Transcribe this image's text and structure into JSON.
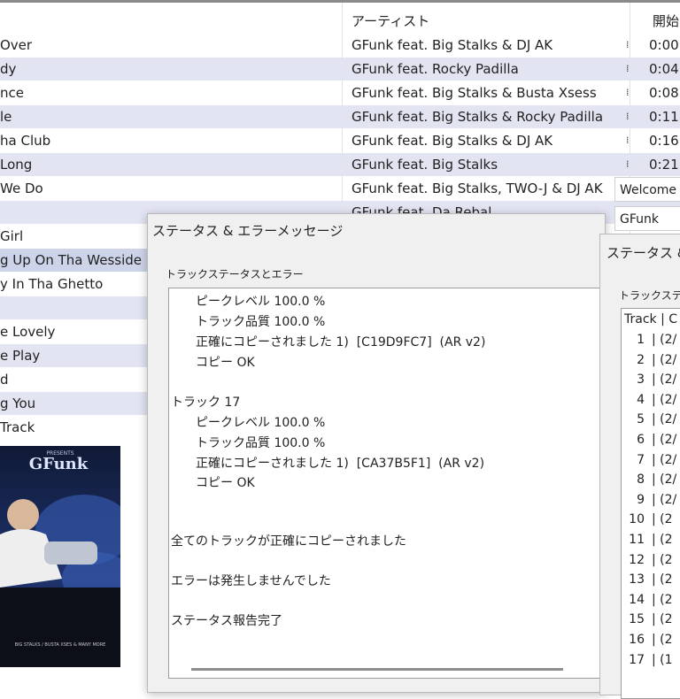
{
  "columns": {
    "artist": "アーティスト",
    "start": "開始"
  },
  "tracks": [
    {
      "title": "Over",
      "artist": "GFunk feat. Big Stalks & DJ AK",
      "start": "0:00:",
      "mark": "⁞"
    },
    {
      "title": "dy",
      "artist": "GFunk feat. Rocky Padilla",
      "start": "0:04:",
      "mark": "⁞"
    },
    {
      "title": "nce",
      "artist": "GFunk feat. Big Stalks & Busta Xsess",
      "start": "0:08:",
      "mark": "⁞"
    },
    {
      "title": "le",
      "artist": "GFunk feat. Big Stalks & Rocky Padilla",
      "start": "0:11:",
      "mark": "⁞"
    },
    {
      "title": "ha Club",
      "artist": "GFunk feat. Big Stalks & DJ AK",
      "start": "0:16:",
      "mark": "⁞"
    },
    {
      "title": " Long",
      "artist": "GFunk feat. Big Stalks",
      "start": "0:21:",
      "mark": "⁞"
    },
    {
      "title": "We Do",
      "artist": "GFunk feat. Big Stalks, TWO-J & DJ AK",
      "start": "",
      "mark": "⁞"
    },
    {
      "title": "",
      "artist": "GFunk feat. Da Rebal",
      "start": "",
      "mark": ""
    },
    {
      "title": "Girl",
      "artist": "",
      "start": "",
      "mark": ""
    },
    {
      "title": "g Up On Tha Wesside",
      "artist": "",
      "start": "",
      "mark": ""
    },
    {
      "title": "y In Tha Ghetto",
      "artist": "",
      "start": "",
      "mark": ""
    },
    {
      "title": "",
      "artist": "",
      "start": "",
      "mark": ""
    },
    {
      "title": "e Lovely",
      "artist": "",
      "start": "",
      "mark": ""
    },
    {
      "title": "e Play",
      "artist": "",
      "start": "",
      "mark": ""
    },
    {
      "title": "d",
      "artist": "",
      "start": "",
      "mark": ""
    },
    {
      "title": "g You",
      "artist": "",
      "start": "",
      "mark": ""
    },
    {
      "title": "Track",
      "artist": "",
      "start": "",
      "mark": ""
    }
  ],
  "fields": {
    "album": "Welcome",
    "artist": "GFunk"
  },
  "status_dialog": {
    "title": "ステータス & エラーメッセージ",
    "label": "トラックステータスとエラー",
    "lines": [
      "ピークレベル 100.0 %",
      "トラック品質 100.0 %",
      "正確にコピーされました 1)  [C19D9FC7]  (AR v2)",
      "コピー OK",
      "トラック 17",
      "ピークレベル 100.0 %",
      "トラック品質 100.0 %",
      "正確にコピーされました 1)  [CA37B5F1]  (AR v2)",
      "コピー OK",
      "全てのトラックが正確にコピーされました",
      "エラーは発生しませんでした",
      "ステータス報告完了"
    ]
  },
  "second_dialog": {
    "title": "ステータス & エ",
    "label": "トラックステー",
    "header": "Track | C",
    "rows": [
      {
        "n": "1",
        "v": "| (2/"
      },
      {
        "n": "2",
        "v": "| (2/"
      },
      {
        "n": "3",
        "v": "| (2/"
      },
      {
        "n": "4",
        "v": "| (2/"
      },
      {
        "n": "5",
        "v": "| (2/"
      },
      {
        "n": "6",
        "v": "| (2/"
      },
      {
        "n": "7",
        "v": "| (2/"
      },
      {
        "n": "8",
        "v": "| (2/"
      },
      {
        "n": "9",
        "v": "| (2/"
      },
      {
        "n": "10",
        "v": "| (2"
      },
      {
        "n": "11",
        "v": "| (2"
      },
      {
        "n": "12",
        "v": "| (2"
      },
      {
        "n": "13",
        "v": "| (2"
      },
      {
        "n": "14",
        "v": "| (2"
      },
      {
        "n": "15",
        "v": "| (2"
      },
      {
        "n": "16",
        "v": "| (2"
      },
      {
        "n": "17",
        "v": "| (1"
      }
    ]
  },
  "cover": {
    "brand": "PRESENTS",
    "logo": "GFunk",
    "small_text": "BIG STALKS / BUSTA XSES & MANY MORE"
  }
}
